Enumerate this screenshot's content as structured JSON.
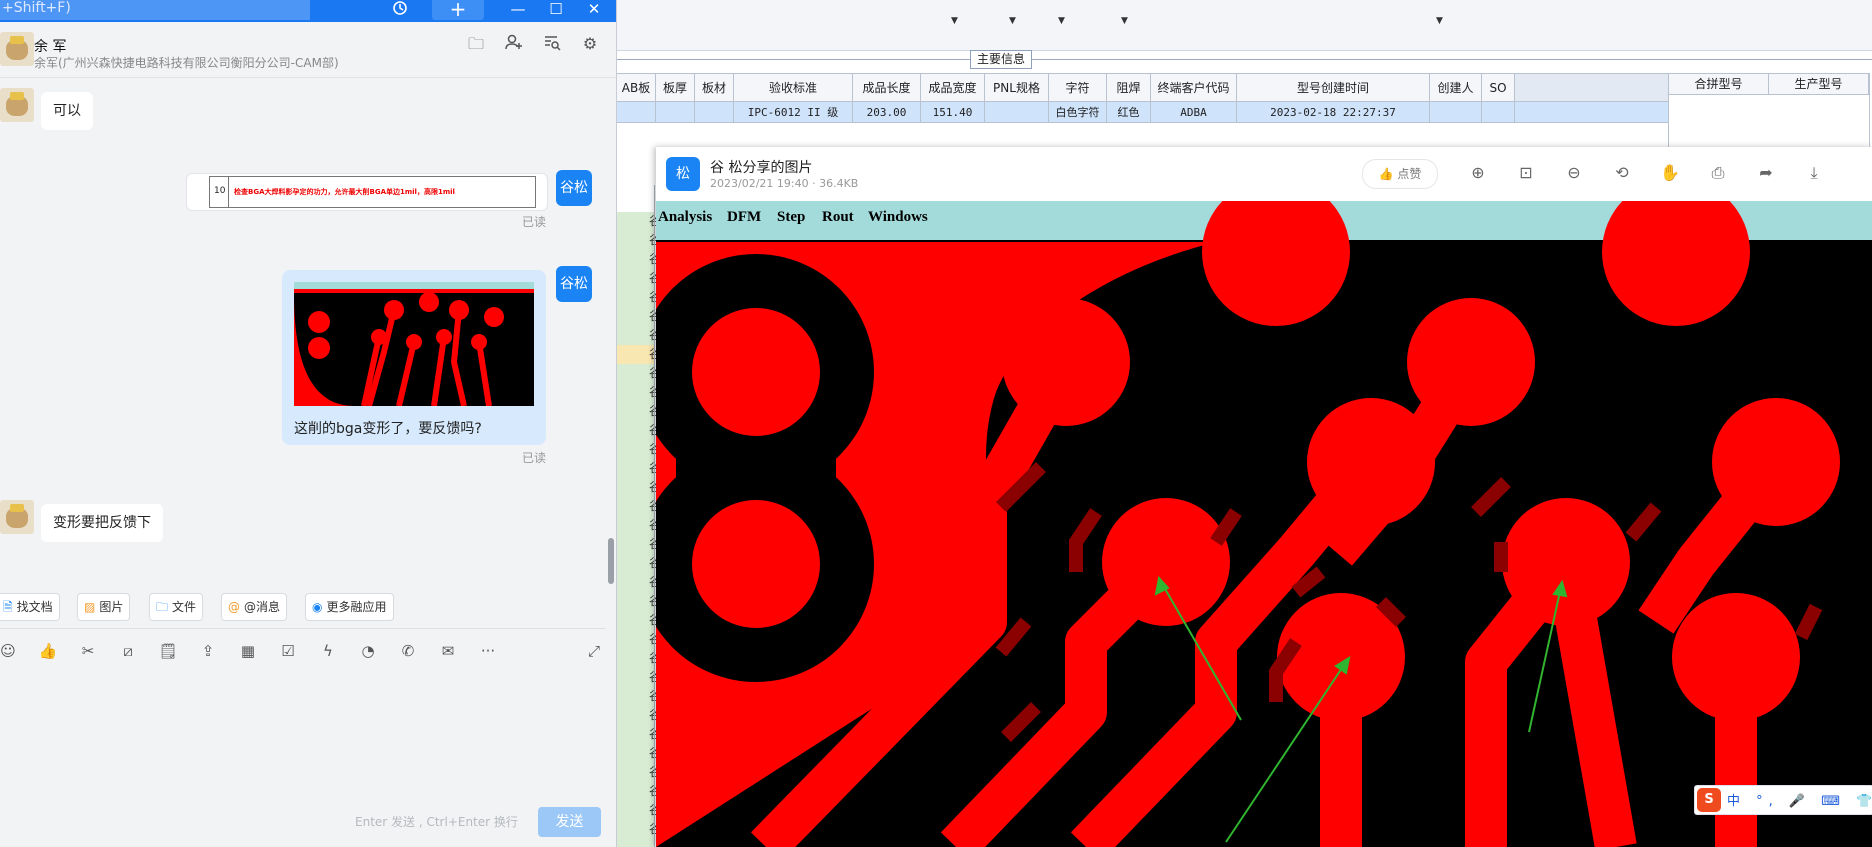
{
  "chat": {
    "search_placeholder": "+Shift+F)",
    "plus": "+",
    "contact_name": "余 军",
    "contact_org": "余军(广州兴森快捷电路科技有限公司衡阳分公司-CAM部)",
    "messages": {
      "m1": "可以",
      "doc_num": "10",
      "doc_text": "检查BGA大焊料影孕定的功力，允许最大削BGA单边1mil，高限1mil",
      "me_name": "谷松",
      "read1": "已读",
      "img_caption": "这削的bga变形了，要反馈吗?",
      "read2": "已读",
      "m3": "变形要把反馈下"
    },
    "quick_actions": [
      "找文档",
      "图片",
      "文件",
      "@消息",
      "更多融应用"
    ],
    "input_hint": "Enter 发送 , Ctrl+Enter 换行",
    "send_label": "发送"
  },
  "erp": {
    "section_label": "主要信息",
    "columns": [
      "AB板",
      "板厚",
      "板材",
      "验收标准",
      "成品长度",
      "成品宽度",
      "PNL规格",
      "字符",
      "阻焊",
      "终端客户代码",
      "型号创建时间",
      "创建人",
      "SO"
    ],
    "row": [
      "",
      "",
      "",
      "IPC-6012 II 级",
      "203.00",
      "151.40",
      "",
      "白色字符",
      "红色",
      "ADBA",
      "2023-02-18 22:27:37",
      "",
      ""
    ],
    "right_columns": [
      "合拼型号",
      "生产型号"
    ],
    "left_column_char": "谷"
  },
  "viewer": {
    "avatar_char": "松",
    "title": "谷 松分享的图片",
    "meta": "2023/02/21 19:40 · 36.4KB",
    "like": "点赞",
    "cam_menu": [
      "Analysis",
      "DFM",
      "Step",
      "Rout",
      "Windows"
    ]
  },
  "ime": {
    "logo": "S",
    "text": "中 °, 🎤 ⌨ 👕 ⊞"
  },
  "colors": {
    "pcb_red": "#ff0000",
    "pcb_dark_red": "#8b0000",
    "arrow_green": "#2fb52f",
    "accent_blue": "#1a84f5",
    "cam_menu_bg": "#a3dada"
  }
}
